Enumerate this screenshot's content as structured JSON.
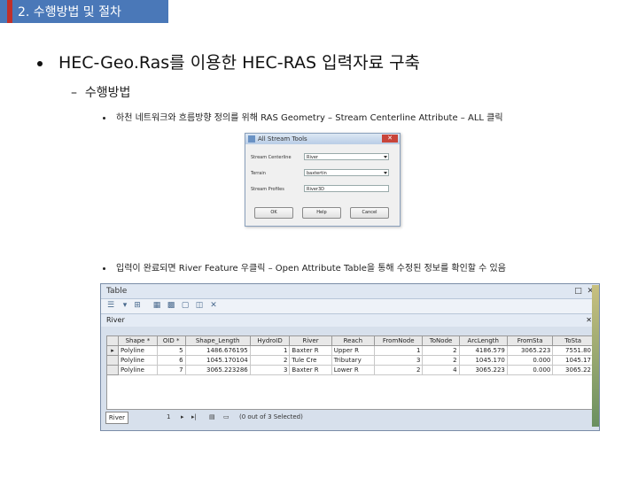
{
  "header": {
    "title": "2. 수행방법 및 절차"
  },
  "bullets": {
    "level1": "HEC-Geo.Ras를 이용한 HEC-RAS 입력자료 구축",
    "level2": "수행방법",
    "level3a": "하천 네트워크와 흐름방향 정의를 위해 RAS Geometry – Stream Centerline Attribute – ALL 클릭",
    "level3b": "입력이 완료되면 River Feature 우클릭 – Open Attribute Table을 통해 수정된 정보를 확인할 수 있음"
  },
  "dialog": {
    "title": "All Stream Tools",
    "fields": [
      {
        "label": "Stream Centerline",
        "value": "River"
      },
      {
        "label": "Terrain",
        "value": "baxtertin"
      },
      {
        "label": "Stream Profiles",
        "value": "River3D"
      }
    ],
    "buttons": {
      "ok": "OK",
      "help": "Help",
      "cancel": "Cancel"
    }
  },
  "table_window": {
    "title": "Table",
    "tab": "River",
    "columns": [
      "Shape *",
      "OID *",
      "Shape_Length",
      "HydroID",
      "River",
      "Reach",
      "FromNode",
      "ToNode",
      "ArcLength",
      "FromSta",
      "ToSta"
    ],
    "rows": [
      [
        "Polyline",
        "5",
        "1486.676195",
        "1",
        "Baxter R",
        "Upper R",
        "1",
        "2",
        "4186.579",
        "3065.223",
        "7551.80"
      ],
      [
        "Polyline",
        "6",
        "1045.170104",
        "2",
        "Tule Cre",
        "Tributary",
        "3",
        "2",
        "1045.170",
        "0.000",
        "1045.17"
      ],
      [
        "Polyline",
        "7",
        "3065.223286",
        "3",
        "Baxter R",
        "Lower R",
        "2",
        "4",
        "3065.223",
        "0.000",
        "3065.22"
      ]
    ],
    "nav": {
      "record": "1",
      "selected_text": "(0 out of 3 Selected)"
    },
    "bottom_tab": "River"
  }
}
